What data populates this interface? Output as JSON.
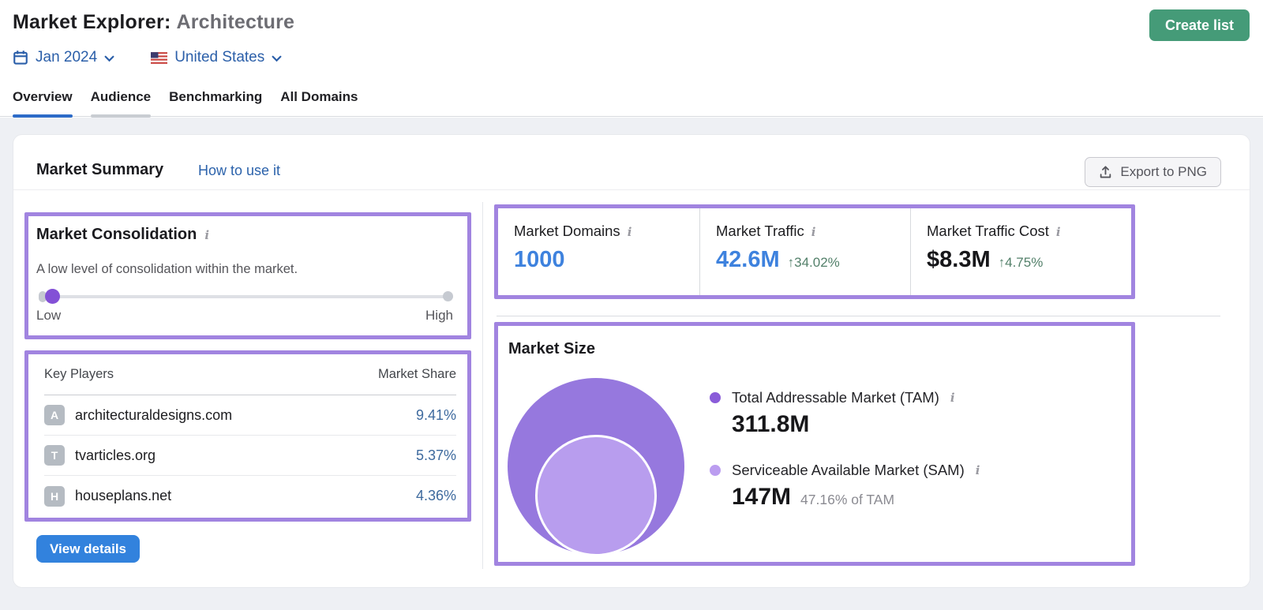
{
  "header": {
    "title_prefix": "Market Explorer:",
    "title_market": "Architecture",
    "create_list_label": "Create list",
    "filters": {
      "date_label": "Jan 2024",
      "country_label": "United States"
    }
  },
  "tabs": [
    {
      "label": "Overview",
      "active": true
    },
    {
      "label": "Audience",
      "active": false
    },
    {
      "label": "Benchmarking",
      "active": false
    },
    {
      "label": "All Domains",
      "active": false
    }
  ],
  "market_summary": {
    "title": "Market Summary",
    "how_to_use_label": "How to use it",
    "export_button_label": "Export to PNG"
  },
  "consolidation": {
    "title": "Market Consolidation",
    "description": "A low level of consolidation within the market.",
    "scale_low_label": "Low",
    "scale_high_label": "High",
    "slider_position_percent": 3
  },
  "key_players": {
    "header_player": "Key Players",
    "header_share": "Market Share",
    "rows": [
      {
        "initial": "A",
        "domain": "architecturaldesigns.com",
        "share": "9.41%"
      },
      {
        "initial": "T",
        "domain": "tvarticles.org",
        "share": "5.37%"
      },
      {
        "initial": "H",
        "domain": "houseplans.net",
        "share": "4.36%"
      }
    ],
    "view_details_label": "View details"
  },
  "stats": [
    {
      "label": "Market Domains",
      "value": "1000"
    },
    {
      "label": "Market Traffic",
      "value": "42.6M",
      "delta": "↑34.02%"
    },
    {
      "label": "Market Traffic Cost",
      "value": "$8.3M",
      "delta": "↑4.75%"
    }
  ],
  "market_size": {
    "title": "Market Size",
    "tam": {
      "label": "Total Addressable Market (TAM)",
      "value": "311.8M"
    },
    "sam": {
      "label": "Serviceable Available Market (SAM)",
      "value": "147M",
      "note": "47.16% of TAM"
    }
  },
  "chart_data": {
    "type": "bubble",
    "title": "Market Size",
    "series": [
      {
        "name": "Total Addressable Market (TAM)",
        "value": 311800000,
        "value_label": "311.8M",
        "color": "#8a5cd9"
      },
      {
        "name": "Serviceable Available Market (SAM)",
        "value": 147000000,
        "value_label": "147M",
        "percent_of_tam": 47.16,
        "color": "#bb9df0"
      }
    ],
    "legend_position": "right"
  },
  "icons": {
    "info": "i"
  },
  "colors": {
    "annotation_purple": "#a184e0",
    "tam_bubble": "#9678de",
    "sam_bubble": "#b89dee",
    "value_blue": "#3e82de",
    "delta_green": "#53806a",
    "link_blue": "#2b62ab",
    "create_list_green": "#459b78",
    "view_details_blue": "#3282dd",
    "active_tab_blue": "#2d6bc8"
  }
}
